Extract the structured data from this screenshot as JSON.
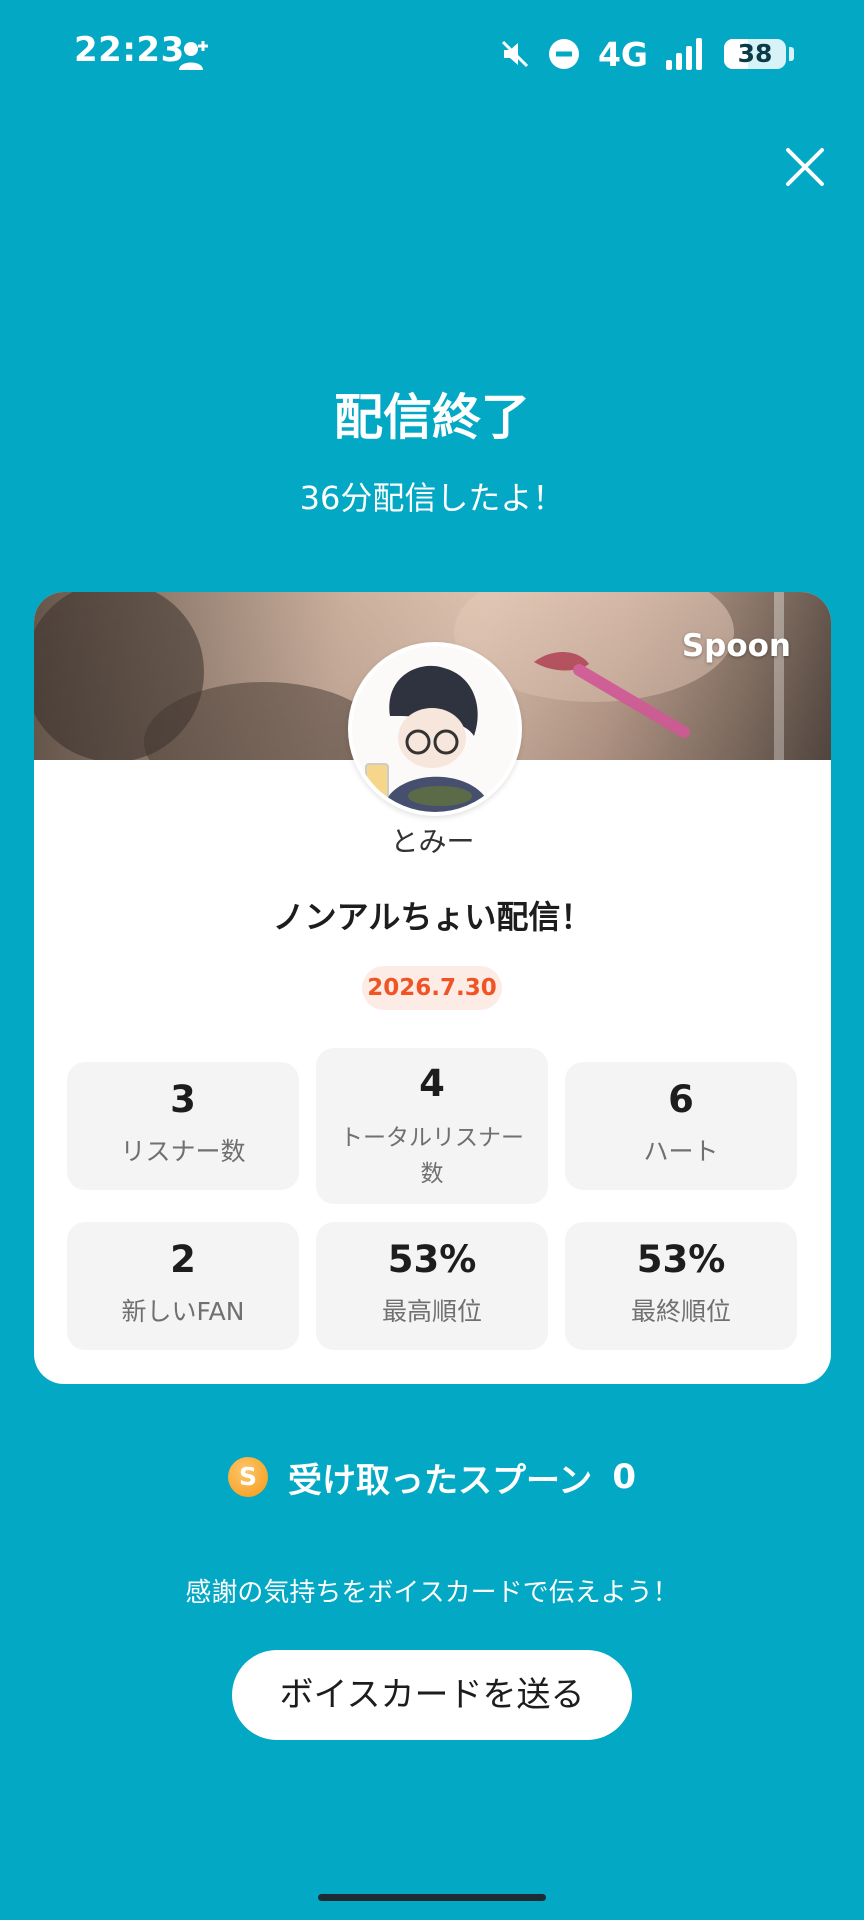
{
  "status_bar": {
    "time": "22:23",
    "network": "4G",
    "battery": "38",
    "battery_level_percent": 38,
    "icons": [
      "person-add-icon",
      "mute-icon",
      "do-not-disturb-icon",
      "signal-icon",
      "battery-icon"
    ]
  },
  "header": {
    "close_icon": "close-icon",
    "title": "配信終了",
    "subtitle": "36分配信したよ！"
  },
  "card": {
    "brand": "Spoon",
    "host_name": "とみー",
    "show_title": "ノンアルちょい配信！",
    "date": "2026.7.30",
    "date_color": "#F05424",
    "stats": [
      {
        "value": "3",
        "label": "リスナー数"
      },
      {
        "value": "4",
        "label_line1": "トータルリスナー",
        "label_line2": "数"
      },
      {
        "value": "6",
        "label": "ハート"
      },
      {
        "value": "2",
        "label": "新しいFAN"
      },
      {
        "value": "53%",
        "label": "最高順位"
      },
      {
        "value": "53%",
        "label": "最終順位"
      }
    ]
  },
  "spoons": {
    "coin_letter": "S",
    "label": "受け取ったスプーン",
    "count": "0"
  },
  "footer": {
    "thanks_text": "感謝の気持ちをボイスカードで伝えよう！",
    "send_button_label": "ボイスカードを送る"
  },
  "colors": {
    "background": "#02A8C4",
    "card": "#FFFFFF",
    "stat_tile": "#F4F4F4",
    "coin": "#F49A16"
  }
}
